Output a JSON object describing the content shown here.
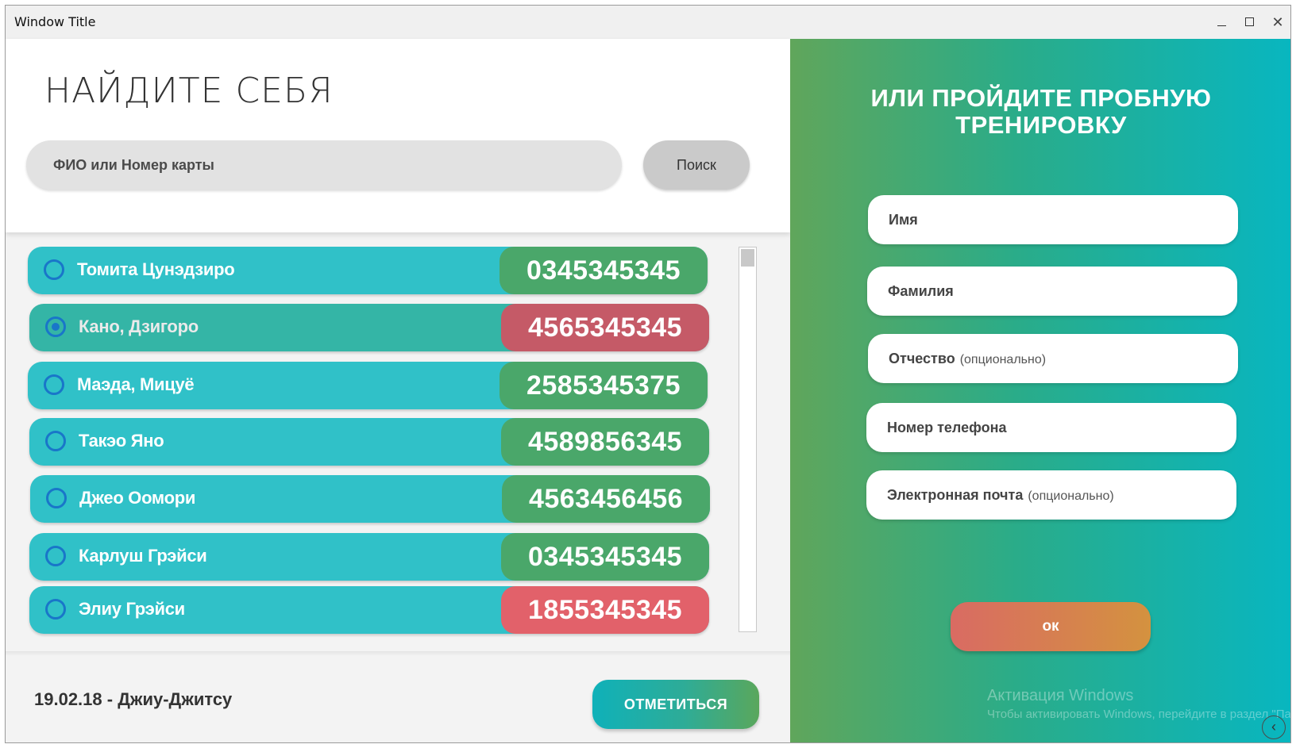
{
  "window": {
    "title": "Window Title",
    "minimize_glyph": "–",
    "maximize_glyph": "□",
    "close_glyph": "✕"
  },
  "search": {
    "heading": "НАЙДИТЕ СЕБЯ",
    "placeholder": "ФИО или Номер карты",
    "button_label": "Поиск"
  },
  "members": [
    {
      "name": "Томита Цунэдзиро",
      "card": "0345345345",
      "card_color": "#4aa76a",
      "selected": false
    },
    {
      "name": "Кано, Дзигоро",
      "card": "4565345345",
      "card_color": "#c55a67",
      "selected": true
    },
    {
      "name": "Маэда, Мицуё",
      "card": "2585345375",
      "card_color": "#4aa76a",
      "selected": false
    },
    {
      "name": "Такэо Яно",
      "card": "4589856345",
      "card_color": "#4aa76a",
      "selected": false
    },
    {
      "name": "Джео Оомори",
      "card": "4563456456",
      "card_color": "#4aa76a",
      "selected": false
    },
    {
      "name": "Карлуш Грэйси",
      "card": "0345345345",
      "card_color": "#4aa76a",
      "selected": false
    },
    {
      "name": "Элиу Грэйси",
      "card": "1855345345",
      "card_color": "#e2616a",
      "selected": false
    }
  ],
  "footer": {
    "session": "19.02.18 - Джиу-Джитсу",
    "checkin_label": "ОТМЕТИТЬСЯ"
  },
  "trial": {
    "title_line1": "ИЛИ ПРОЙДИТЕ ПРОБНУЮ",
    "title_line2": "ТРЕНИРОВКУ",
    "fields": [
      {
        "label": "Имя",
        "optional": ""
      },
      {
        "label": "Фамилия",
        "optional": ""
      },
      {
        "label": "Отчество",
        "optional": "(опционально)"
      },
      {
        "label": "Номер телефона",
        "optional": ""
      },
      {
        "label": "Электронная почта",
        "optional": "(опционально)"
      }
    ],
    "ok_label": "ок"
  },
  "watermark": {
    "line1": "Активация Windows",
    "line2": "Чтобы активировать Windows, перейдите в раздел \"Па"
  },
  "colors": {
    "row_default": "#30c1c8",
    "row_selected": "#34b5a6",
    "accent_blue": "#1976c9"
  },
  "icons": {
    "corner_button": "chevron-left-icon"
  }
}
